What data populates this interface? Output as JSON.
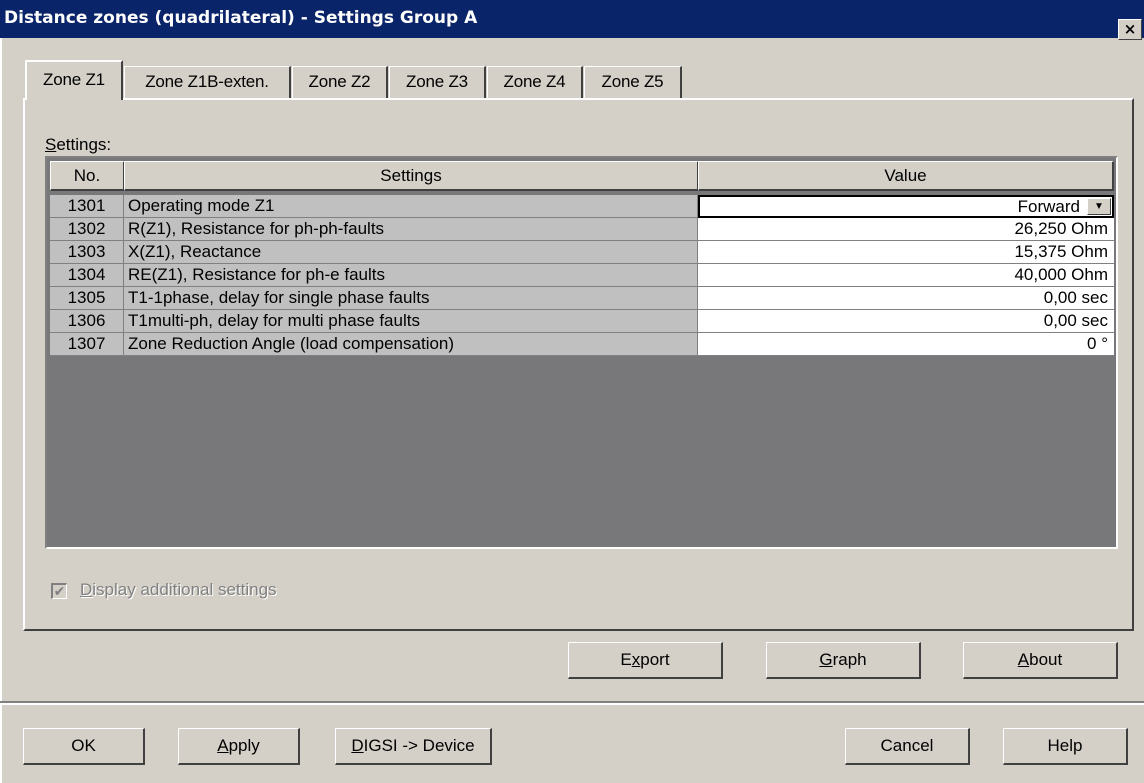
{
  "window": {
    "title": "Distance zones (quadrilateral) - Settings Group A",
    "close_label": "×"
  },
  "tabs": [
    {
      "label": "Zone Z1",
      "active": true
    },
    {
      "label": "Zone Z1B-exten.",
      "active": false
    },
    {
      "label": "Zone Z2",
      "active": false
    },
    {
      "label": "Zone Z3",
      "active": false
    },
    {
      "label": "Zone Z4",
      "active": false
    },
    {
      "label": "Zone Z5",
      "active": false
    }
  ],
  "settings_label": {
    "mnemonic": "S",
    "rest": "ettings:"
  },
  "table": {
    "headers": {
      "no": "No.",
      "settings": "Settings",
      "value": "Value"
    },
    "rows": [
      {
        "no": "1301",
        "setting": "Operating mode Z1",
        "value": "Forward"
      },
      {
        "no": "1302",
        "setting": "R(Z1), Resistance for ph-ph-faults",
        "value": "26,250 Ohm"
      },
      {
        "no": "1303",
        "setting": "X(Z1), Reactance",
        "value": "15,375 Ohm"
      },
      {
        "no": "1304",
        "setting": "RE(Z1), Resistance for ph-e faults",
        "value": "40,000 Ohm"
      },
      {
        "no": "1305",
        "setting": "T1-1phase, delay for single phase faults",
        "value": "0,00 sec"
      },
      {
        "no": "1306",
        "setting": "T1multi-ph, delay for multi phase faults",
        "value": "0,00 sec"
      },
      {
        "no": "1307",
        "setting": "Zone Reduction Angle (load compensation)",
        "value": "0 °"
      }
    ],
    "dropdown_arrow": "▼"
  },
  "display_additional": {
    "checked": true,
    "check_glyph": "✔",
    "mnemonic": "D",
    "rest": "isplay additional settings"
  },
  "panel_buttons": {
    "export": {
      "pre": "E",
      "mnemonic": "x",
      "post": "port"
    },
    "graph": {
      "pre": "",
      "mnemonic": "G",
      "post": "raph"
    },
    "about": {
      "pre": "",
      "mnemonic": "A",
      "post": "bout"
    }
  },
  "footer_buttons": {
    "ok": "OK",
    "apply": {
      "mnemonic": "A",
      "post": "pply"
    },
    "digsi": {
      "mnemonic": "D",
      "post": "IGSI -> Device"
    },
    "cancel": "Cancel",
    "help": "Help"
  }
}
